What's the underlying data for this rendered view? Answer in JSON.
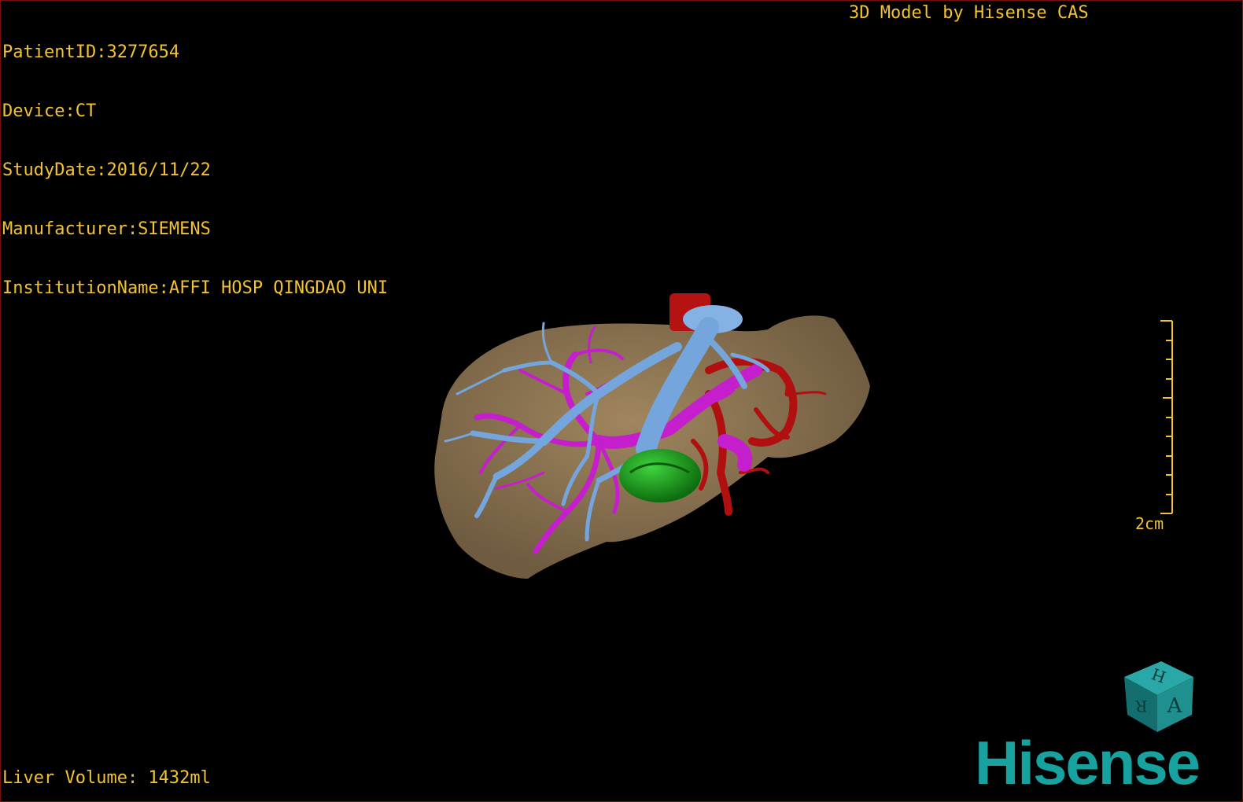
{
  "header": {
    "patient_id": "PatientID:3277654",
    "device": "Device:CT",
    "study_date": "StudyDate:2016/11/22",
    "manufacturer": "Manufacturer:SIEMENS",
    "institution": "InstitutionName:AFFI HOSP QINGDAO UNI"
  },
  "credit": "3D Model by Hisense CAS",
  "footer": {
    "liver_volume": "Liver Volume: 1432ml"
  },
  "scale_bar": {
    "label": "2cm"
  },
  "orientation_cube": {
    "faces": [
      "H",
      "R",
      "A"
    ]
  },
  "brand": {
    "logo_text": "Hisense"
  },
  "colors": {
    "overlay_text": "#f2c233",
    "liver": "#8e7656",
    "portal_vein": "#6ea0d8",
    "hepatic_vein": "#c01ec8",
    "artery": "#b01010",
    "tumor": "#1aa51a",
    "cube": "#1f8f8f",
    "brand": "#17a2a0"
  }
}
